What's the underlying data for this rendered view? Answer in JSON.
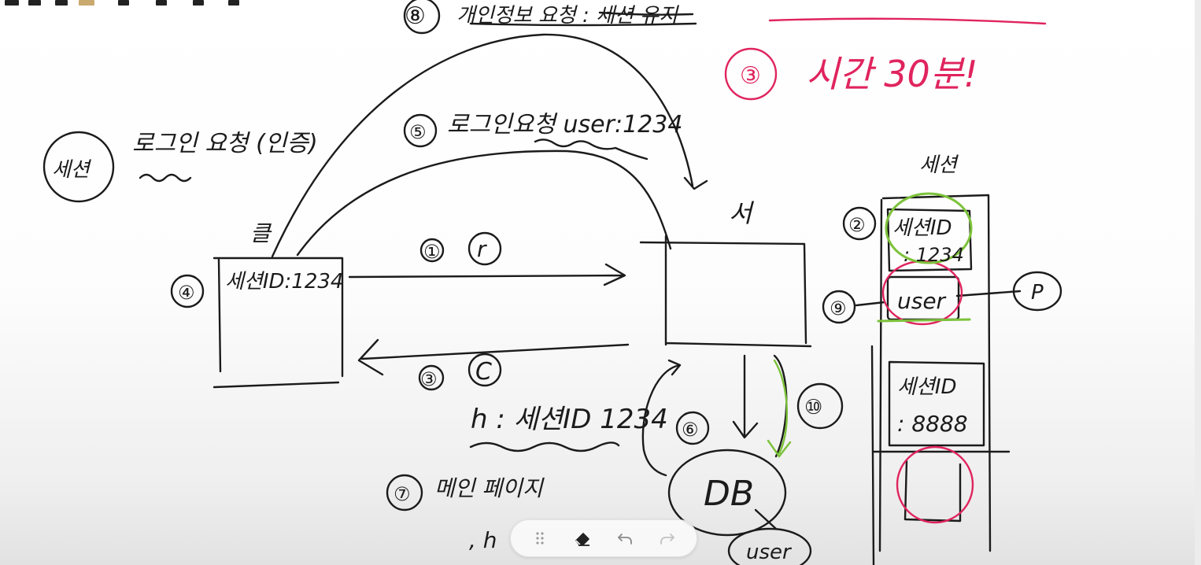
{
  "toolbar": {
    "tools": [
      "drag-handle",
      "eraser",
      "undo",
      "redo"
    ]
  },
  "whiteboard": {
    "session_label": "세션",
    "login_request_label": "로그인 요청 (인증)",
    "client_label": "클",
    "client_box_text": "세션ID:1234",
    "server_label": "서",
    "step1": "①",
    "step1_letter": "r",
    "step2": "②",
    "step3": "③",
    "step3_letter": "C",
    "step4": "④",
    "step5": "⑤",
    "step5_text": "로그인요청 user:1234",
    "step6": "⑥",
    "step7": "⑦",
    "step7_text": "메인 페이지",
    "step7_sub": ", h",
    "step8": "⑧",
    "step8_text": "개인정보 요청 : 세션 유지",
    "step9": "⑨",
    "step10": "⑩",
    "header_text": "h : 세션ID 1234",
    "db_label": "DB",
    "db_user_label": "user",
    "store_label": "세션",
    "store_entry1_key": "세션ID",
    "store_entry1_value": ": 1234",
    "store_user_label": "user",
    "store_entry2_key": "세션ID",
    "store_entry2_value": ": 8888",
    "p_label": "P",
    "time_note_number": "③",
    "time_note_text": "시간 30분!"
  },
  "colors": {
    "ink": "#1b1b1b",
    "red": "#e0245e",
    "green": "#7cc23a"
  }
}
